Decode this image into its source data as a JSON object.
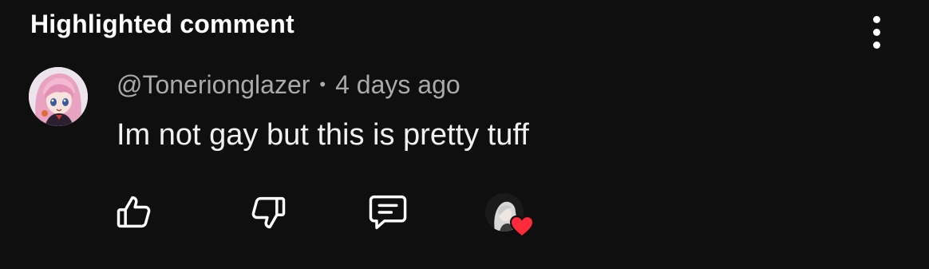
{
  "header": {
    "title": "Highlighted comment"
  },
  "comment": {
    "author": "@Tonerionglazer",
    "separator": "•",
    "time": "4 days ago",
    "text": "Im not gay but this is pretty tuff"
  },
  "colors": {
    "background": "#0f0f0f",
    "text_primary": "#f1f1f1",
    "text_secondary": "#aaaaaa",
    "heart": "#ff2a3a"
  },
  "icons": {
    "like": "thumbs-up-icon",
    "dislike": "thumbs-down-icon",
    "reply": "comment-icon",
    "more": "vertical-ellipsis-icon",
    "heart": "heart-icon"
  }
}
